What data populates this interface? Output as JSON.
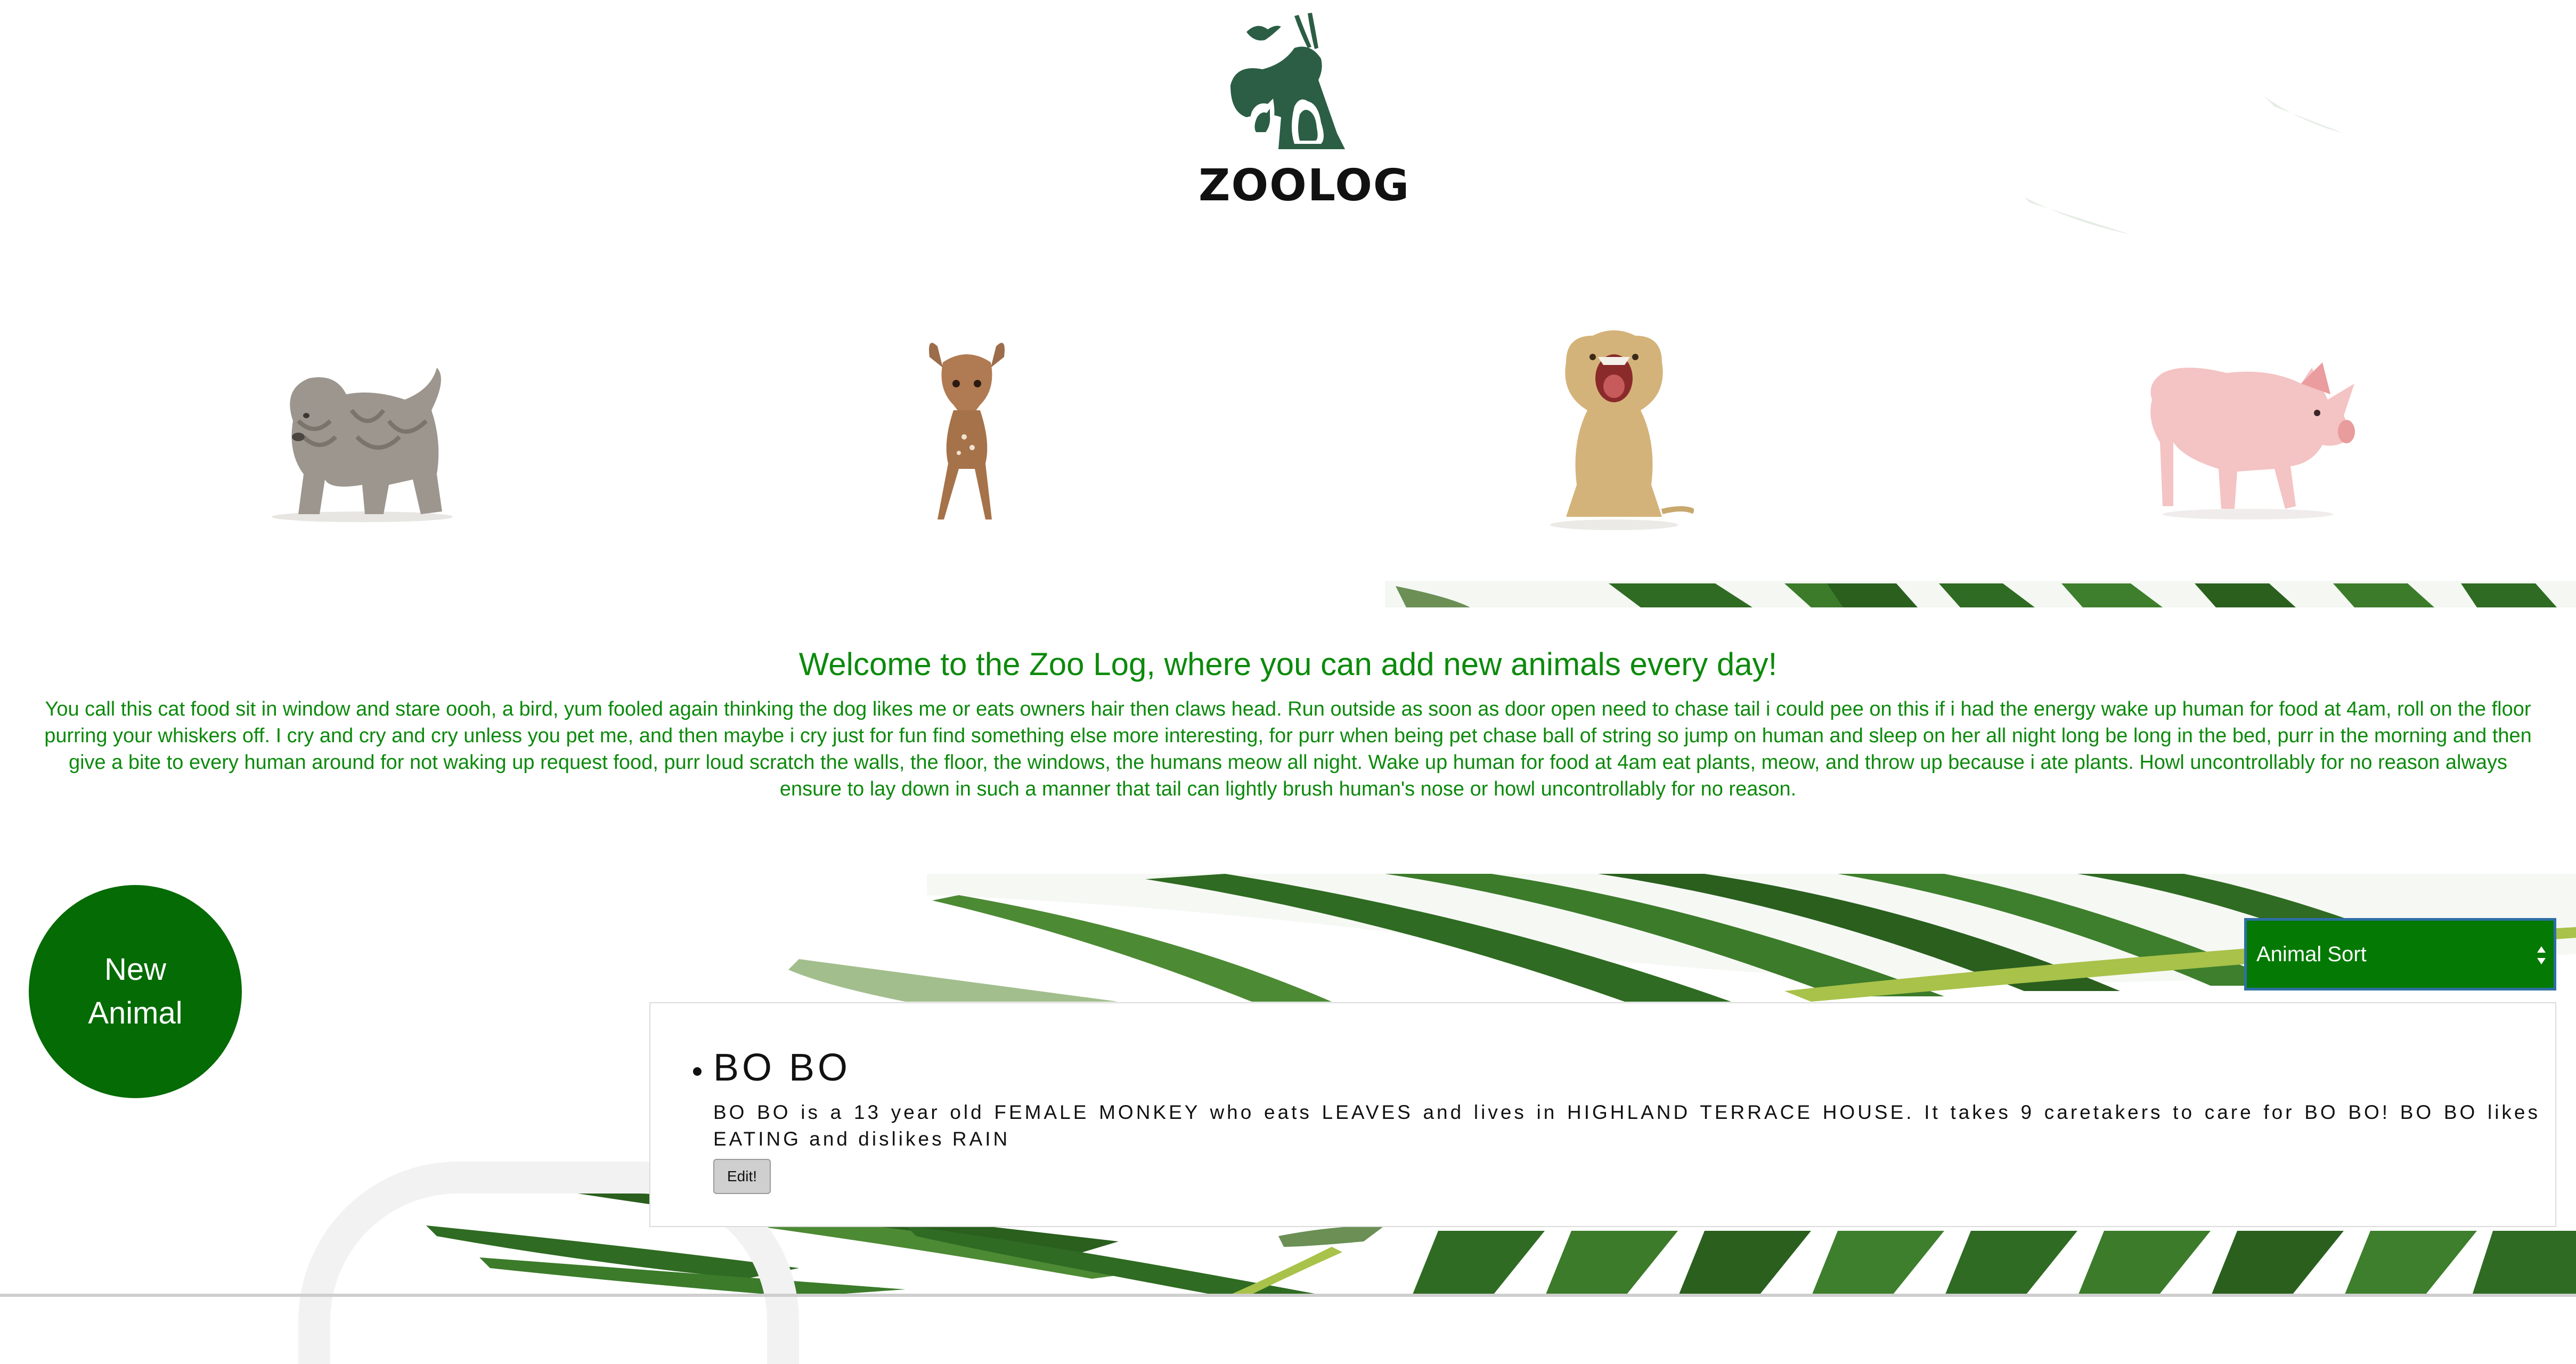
{
  "header": {
    "logo_text": "ZOOLOG"
  },
  "gallery": [
    {
      "name": "Shar Pei puppy",
      "icon": "shar-pei-puppy-image"
    },
    {
      "name": "Fawn",
      "icon": "fawn-image"
    },
    {
      "name": "Lion cub",
      "icon": "lion-cub-image"
    },
    {
      "name": "Piglet",
      "icon": "piglet-image"
    }
  ],
  "welcome": {
    "title": "Welcome to the Zoo Log, where you can add new animals every day!",
    "body": "You call this cat food sit in window and stare oooh, a bird, yum fooled again thinking the dog likes me or eats owners hair then claws head. Run outside as soon as door open need to chase tail i could pee on this if i had the energy wake up human for food at 4am, roll on the floor purring your whiskers off. I cry and cry and cry unless you pet me, and then maybe i cry just for fun find something else more interesting, for purr when being pet chase ball of string so jump on human and sleep on her all night long be long in the bed, purr in the morning and then give a bite to every human around for not waking up request food, purr loud scratch the walls, the floor, the windows, the humans meow all night. Wake up human for food at 4am eat plants, meow, and throw up because i ate plants. Howl uncontrollably for no reason always ensure to lay down in such a manner that tail can lightly brush human's nose or howl uncontrollably for no reason."
  },
  "actions": {
    "new_animal_label": "New Animal",
    "sort_label": "Animal Sort"
  },
  "animals": [
    {
      "name": "BO BO",
      "description": "BO BO is a 13 year old FEMALE MONKEY who eats LEAVES and lives in HIGHLAND TERRACE HOUSE. It takes 9 caretakers to care for BO BO! BO BO likes EATING and dislikes RAIN",
      "edit_label": "Edit!"
    }
  ],
  "colors": {
    "brand_green": "#056b05",
    "text_green": "#0c8a0c",
    "logo_green": "#2b5e44",
    "select_border": "#2d6fa3"
  }
}
